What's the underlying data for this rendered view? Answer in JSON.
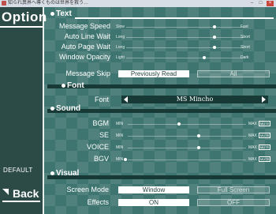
{
  "window": {
    "title": "知られ異界へ導くものは世界を救う…",
    "min": "–",
    "max": "□",
    "close": "×"
  },
  "side": {
    "title": "Option",
    "default_label": "DEFAULT",
    "back_label": "Back"
  },
  "text_section": {
    "heading": "Text",
    "rows": [
      {
        "label": "Message Speed",
        "min": "Slow",
        "max": "Fast",
        "level": 0.85
      },
      {
        "label": "Auto Line Wait",
        "min": "Long",
        "max": "Short",
        "level": 0.85
      },
      {
        "label": "Auto Page Wait",
        "min": "Long",
        "max": "Short",
        "level": 0.85
      },
      {
        "label": "Window Opacity",
        "min": "Light",
        "max": "Dark",
        "level": 0.74
      }
    ],
    "skip": {
      "label": "Message Skip",
      "opt1": "Previously Read",
      "opt2": "All",
      "selected": "Previously Read"
    }
  },
  "font_section": {
    "heading": "Font",
    "label": "Font",
    "value": "MS Mincho"
  },
  "sound_section": {
    "heading": "Sound",
    "rows": [
      {
        "label": "BGM",
        "min": "MIN",
        "max": "MAX",
        "mute": "MUTE",
        "level": 0.47
      },
      {
        "label": "SE",
        "min": "MIN",
        "max": "MAX",
        "mute": "MUTE",
        "level": 0.7
      },
      {
        "label": "VOICE",
        "min": "MIN",
        "max": "MAX",
        "mute": "MUTE",
        "level": 0.7
      },
      {
        "label": "BGV",
        "min": "MIN",
        "max": "MAX",
        "mute": "MUTE",
        "level": 0.05
      }
    ]
  },
  "visual_section": {
    "heading": "Visual",
    "screen_mode": {
      "label": "Screen Mode",
      "opt1": "Window",
      "opt2": "Full Screen",
      "selected": "Window"
    },
    "effects": {
      "label": "Effects",
      "opt1": "ON",
      "opt2": "OFF",
      "selected": "ON"
    }
  }
}
